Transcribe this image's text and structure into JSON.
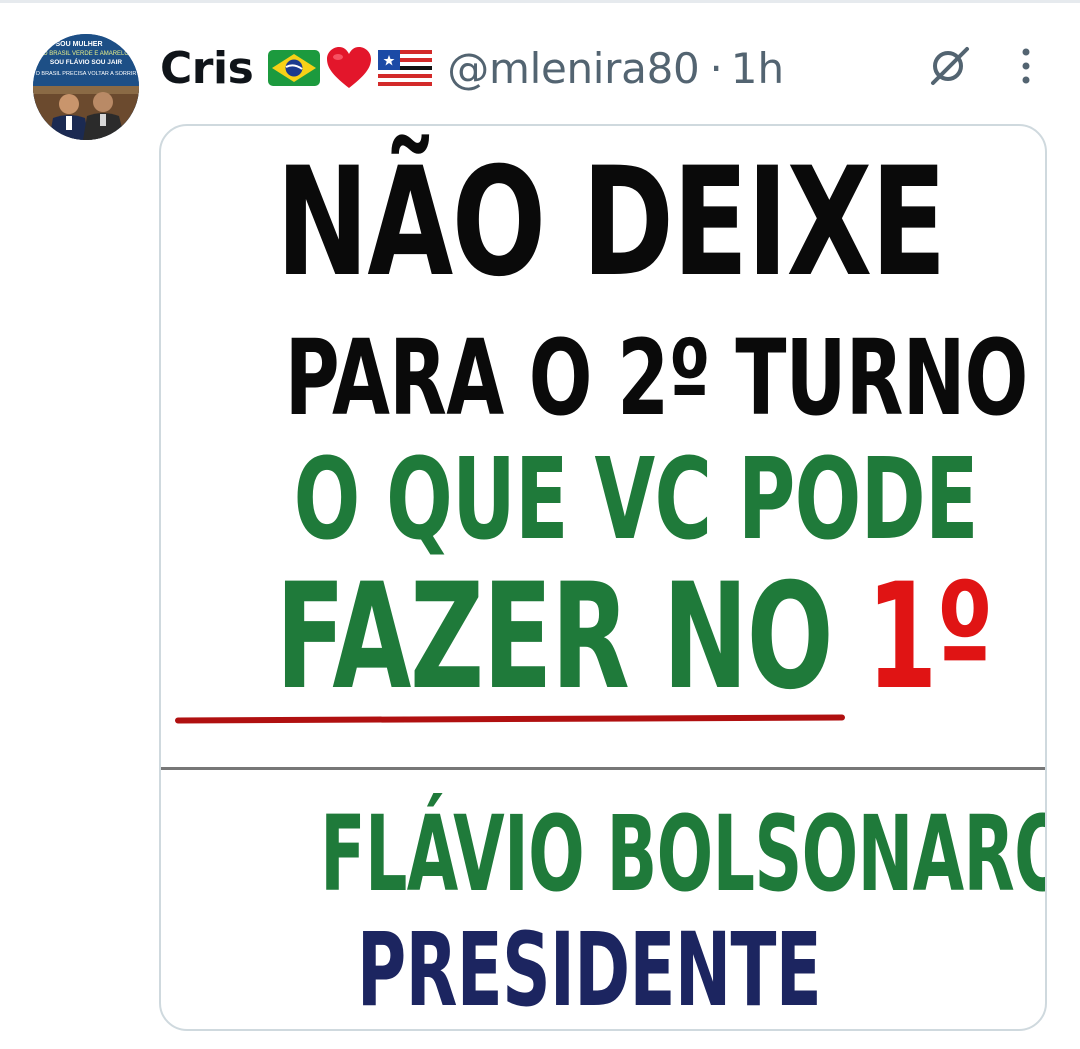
{
  "tweet": {
    "display_name": "Cris",
    "name_emojis": [
      "brazil-flag",
      "red-heart",
      "maranhao-flag"
    ],
    "handle": "@mlenira80",
    "separator": "·",
    "time": "1h",
    "avatar": {
      "banner_lines": [
        "SOU MULHER",
        "O BRASIL VERDE E AMARELO",
        "SOU FLÁVIO SOU JAIR",
        "O BRASIL PRECISA VOLTAR A SORRIR"
      ]
    },
    "actions": {
      "grok_icon": "grok-icon",
      "more_icon": "more-vertical-icon"
    }
  },
  "media": {
    "line1": "NÃO DEIXE",
    "line2": "PARA O 2º TURNO",
    "line3": "O QUE VC PODE",
    "line4_main": "FAZER NO ",
    "line4_accent": "1º",
    "line5": "FLÁVIO BOLSONARO",
    "line6": "PRESIDENTE",
    "colors": {
      "black_text": "#0a0a0a",
      "green_text": "#1f7a3a",
      "red_accent": "#e01414",
      "navy_text": "#1c2560"
    }
  }
}
